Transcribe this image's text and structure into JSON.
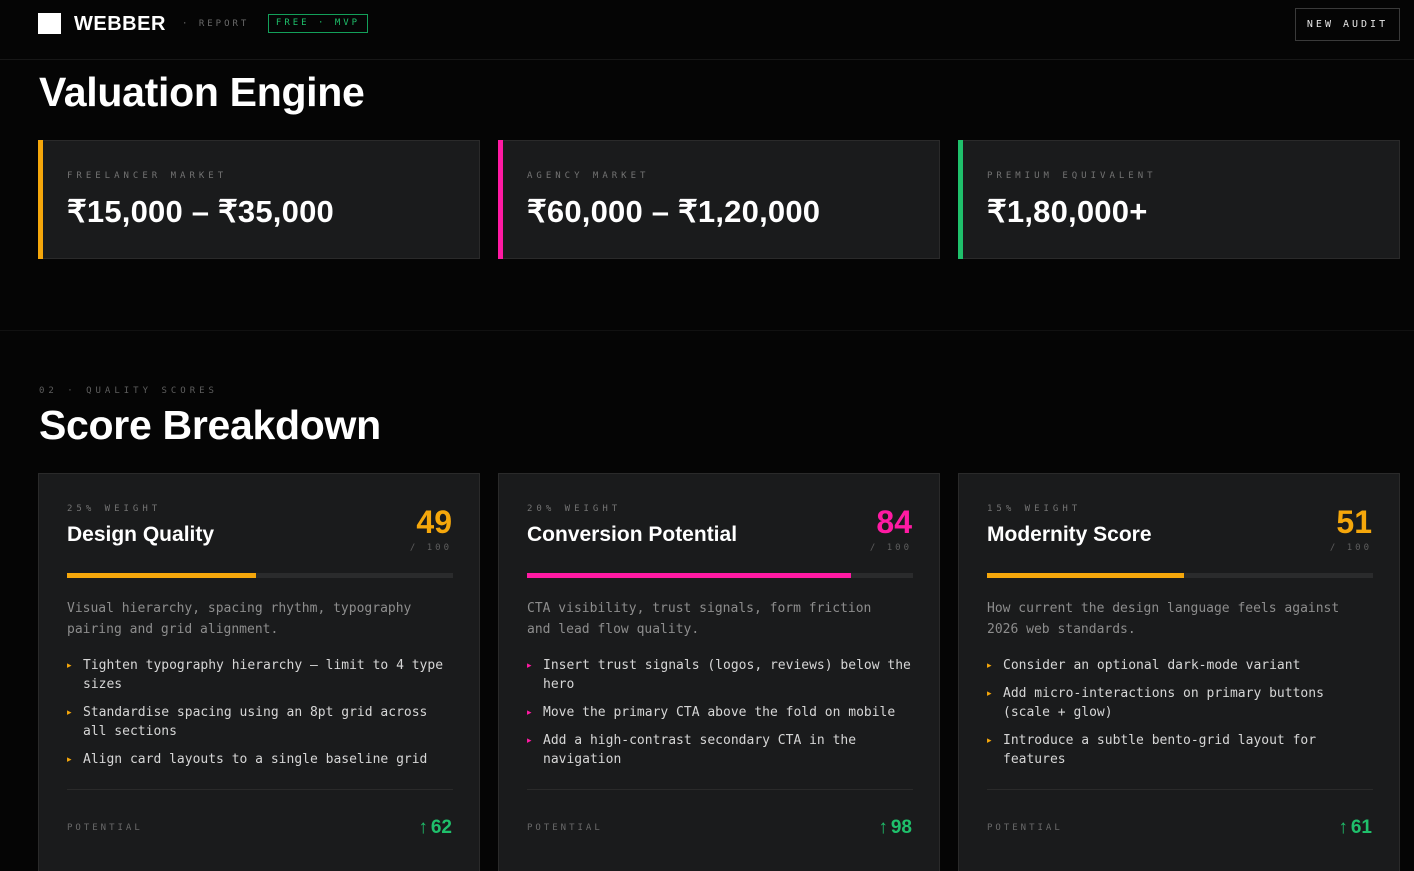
{
  "header": {
    "brand": "WEBBER",
    "crumb": "· REPORT",
    "plan_badge": "FREE · MVP",
    "new_audit_label": "NEW AUDIT"
  },
  "valuation": {
    "title": "Valuation Engine",
    "cards": [
      {
        "label": "FREELANCER MARKET",
        "amount": "₹15,000 – ₹35,000",
        "accent": "#f5a70b"
      },
      {
        "label": "AGENCY MARKET",
        "amount": "₹60,000 – ₹1,20,000",
        "accent": "#ff1aa3"
      },
      {
        "label": "PREMIUM EQUIVALENT",
        "amount": "₹1,80,000+",
        "accent": "#1fc06b"
      }
    ]
  },
  "scores": {
    "kicker": "02 · QUALITY SCORES",
    "title": "Score Breakdown",
    "cards": [
      {
        "weight": "25% WEIGHT",
        "name": "Design Quality",
        "score": "49",
        "out_of": "/ 100",
        "score_value": 49,
        "accent": "#f5a70b",
        "description": "Visual hierarchy, spacing rhythm, typography pairing and grid alignment.",
        "items": [
          "Tighten typography hierarchy — limit to 4 type sizes",
          "Standardise spacing using an 8pt grid across all sections",
          "Align card layouts to a single baseline grid"
        ],
        "potential_label": "POTENTIAL",
        "potential": "62"
      },
      {
        "weight": "20% WEIGHT",
        "name": "Conversion Potential",
        "score": "84",
        "out_of": "/ 100",
        "score_value": 84,
        "accent": "#ff1aa3",
        "description": "CTA visibility, trust signals, form friction and lead flow quality.",
        "items": [
          "Insert trust signals (logos, reviews) below the hero",
          "Move the primary CTA above the fold on mobile",
          "Add a high-contrast secondary CTA in the navigation"
        ],
        "potential_label": "POTENTIAL",
        "potential": "98"
      },
      {
        "weight": "15% WEIGHT",
        "name": "Modernity Score",
        "score": "51",
        "out_of": "/ 100",
        "score_value": 51,
        "accent": "#f5a70b",
        "description": "How current the design language feels against 2026 web standards.",
        "items": [
          "Consider an optional dark-mode variant",
          "Add micro-interactions on primary buttons (scale + glow)",
          "Introduce a subtle bento-grid layout for features"
        ],
        "potential_label": "POTENTIAL",
        "potential": "61"
      }
    ]
  },
  "icons": {
    "logo": "square-logo-icon",
    "bullet": "triangle-bullet-icon",
    "potential": "arrow-up-icon"
  },
  "colors": {
    "background": "#050505",
    "card": "#1a1b1c",
    "yellow": "#f5a70b",
    "pink": "#ff1aa3",
    "green": "#1fc06b"
  }
}
